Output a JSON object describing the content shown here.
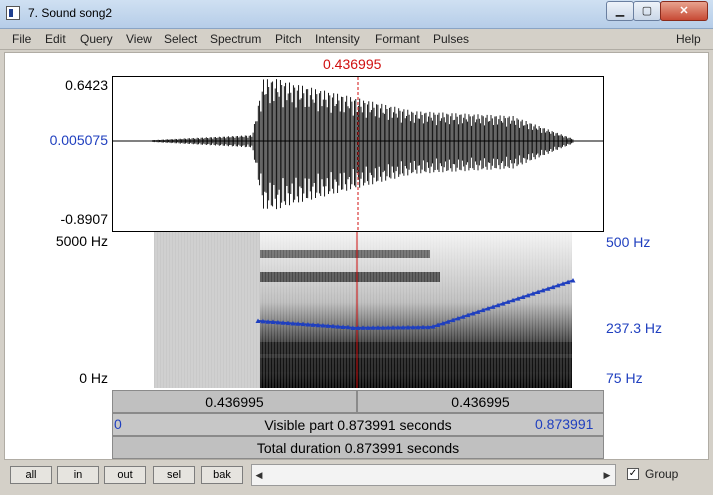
{
  "window": {
    "title": "7. Sound song2",
    "minimize": "▁",
    "maximize": "▢",
    "close": "✕"
  },
  "menu": [
    "File",
    "Edit",
    "Query",
    "View",
    "Select",
    "Spectrum",
    "Pitch",
    "Intensity",
    "Formant",
    "Pulses",
    "Help"
  ],
  "cursor": {
    "time_label": "0.436995",
    "color": "#d01010"
  },
  "waveform": {
    "max": "0.6423",
    "value": "0.005075",
    "min": "-0.8907"
  },
  "spectrogram": {
    "top_freq": "5000 Hz",
    "bottom_freq": "0 Hz"
  },
  "pitch": {
    "top": "500 Hz",
    "mid": "237.3 Hz",
    "bottom": "75 Hz",
    "color": "#1f3fbf"
  },
  "time_bar": {
    "left": "0.436995",
    "right": "0.436995"
  },
  "visible": {
    "start": "0",
    "label": "Visible part 0.873991 seconds",
    "end": "0.873991"
  },
  "total": {
    "label": "Total duration 0.873991 seconds"
  },
  "toolbar": {
    "buttons": [
      "all",
      "in",
      "out",
      "sel",
      "bak"
    ],
    "scroll_left": "◀",
    "scroll_right": "▶",
    "group_checked": "✓",
    "group_label": "Group"
  }
}
